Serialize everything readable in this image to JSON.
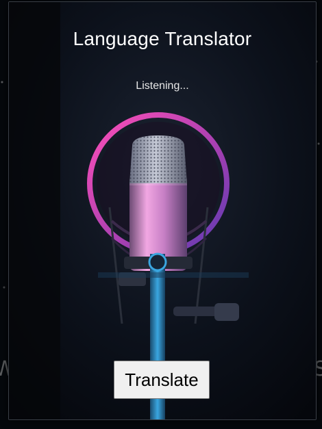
{
  "app": {
    "title": "Language Translator",
    "status": "Listening...",
    "translate_label": "Translate"
  },
  "images": {
    "background_photo": "microphone-studio-photo"
  },
  "colors": {
    "window_bg": "#080b12",
    "title_text": "#ffffff",
    "button_bg": "#f0f0f0",
    "mic_pink": "#e05ac8",
    "mic_blue": "#39a7e0"
  },
  "background": {
    "left_edge_text": "W",
    "right_edge_text": "S"
  }
}
